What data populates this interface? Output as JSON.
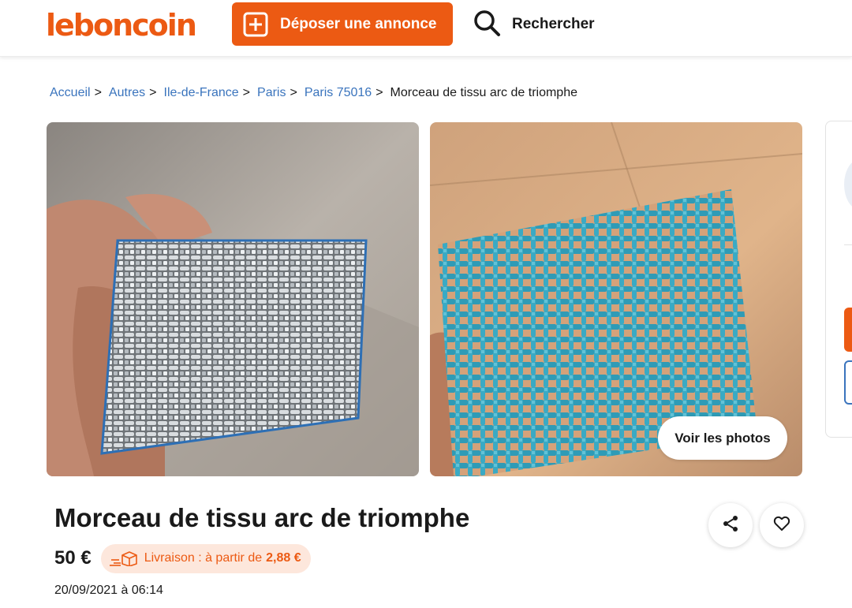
{
  "header": {
    "logo": "leboncoin",
    "post_ad_label": "Déposer une annonce",
    "search_label": "Rechercher"
  },
  "breadcrumb": {
    "items": [
      "Accueil",
      "Autres",
      "Ile-de-France",
      "Paris",
      "Paris 75016"
    ],
    "current": "Morceau de tissu arc de triomphe",
    "separator": ">"
  },
  "gallery": {
    "see_photos_label": "Voir les photos"
  },
  "listing": {
    "title": "Morceau de tissu arc de triomphe",
    "price": "50 €",
    "delivery_label": "Livraison : à partir de",
    "delivery_price": "2,88 €",
    "date": "20/09/2021 à 06:14"
  },
  "icons": {
    "post_ad": "plus-square-icon",
    "search": "search-icon",
    "delivery": "delivery-box-icon",
    "share": "share-icon",
    "favorite": "heart-icon"
  },
  "colors": {
    "brand": "#ec5a13",
    "link": "#3a74bd",
    "delivery_bg": "#fde7dc",
    "text": "#1a1a1a"
  }
}
